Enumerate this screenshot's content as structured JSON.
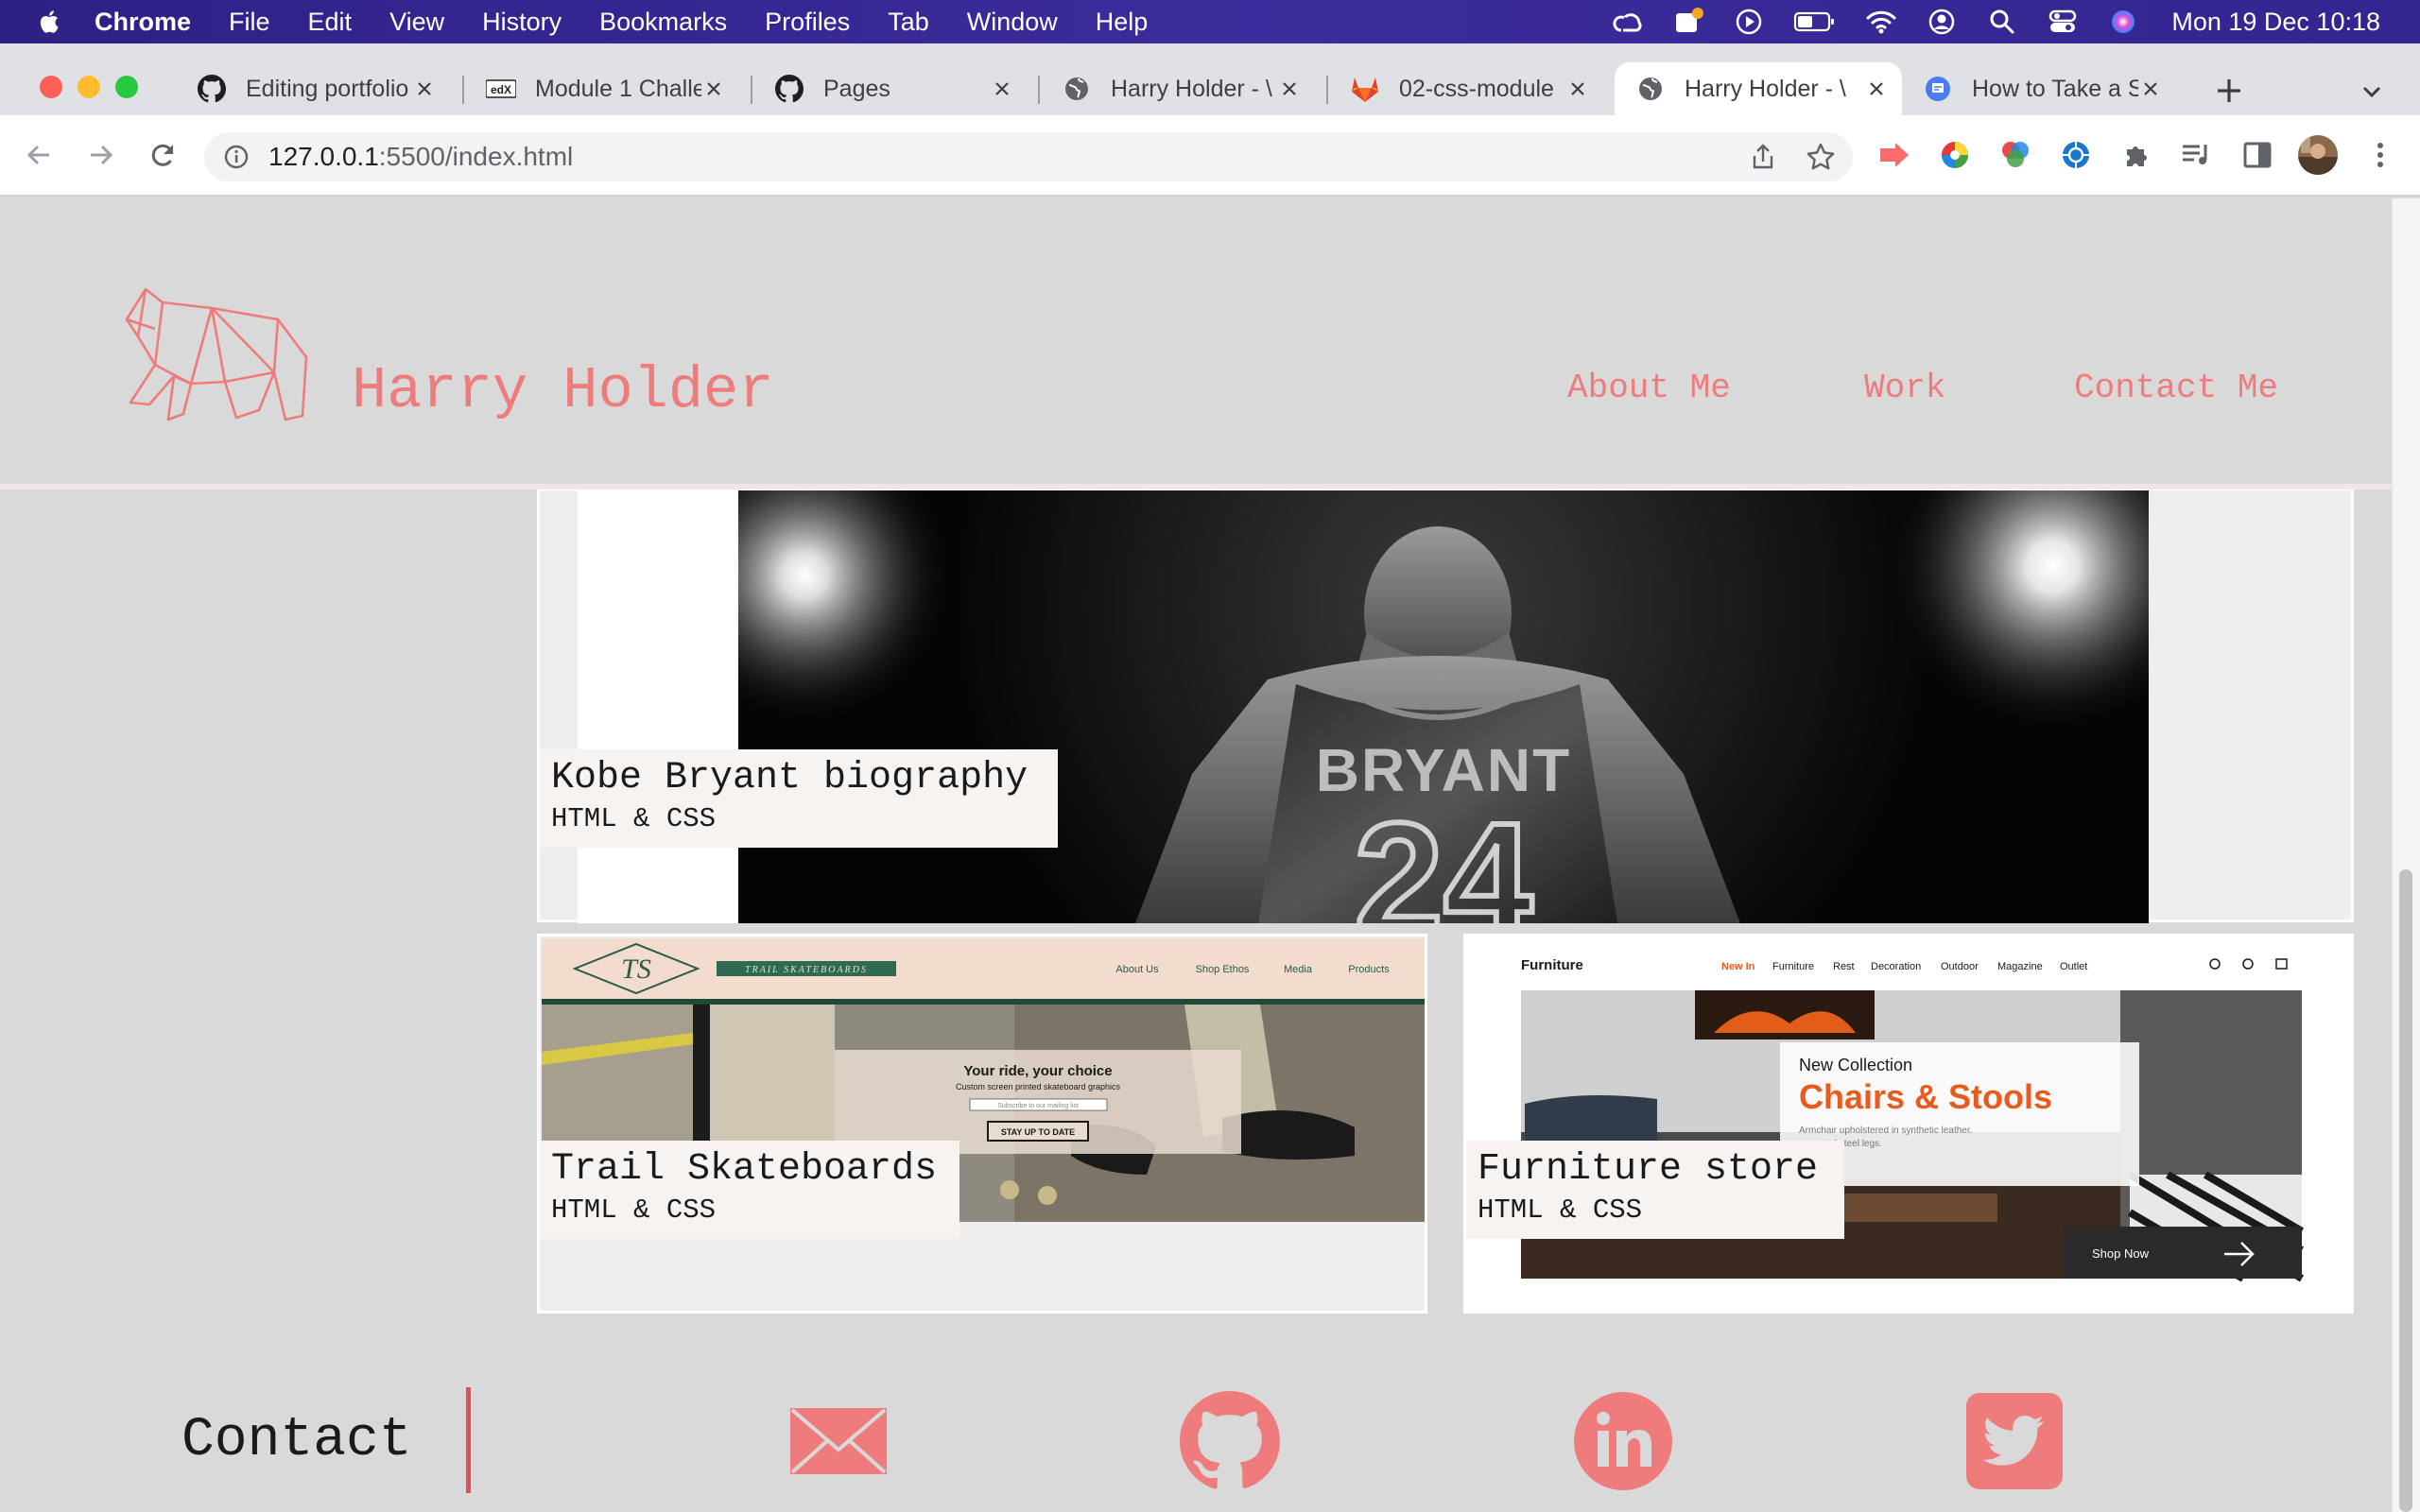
{
  "menubar": {
    "app": "Chrome",
    "menus": [
      "File",
      "Edit",
      "View",
      "History",
      "Bookmarks",
      "Profiles",
      "Tab",
      "Window",
      "Help"
    ],
    "clock": "Mon 19 Dec  10:18",
    "status_icons": [
      "creative-cloud-icon",
      "notification-icon",
      "play-icon",
      "battery-icon",
      "wifi-icon",
      "user-icon",
      "spotlight-icon",
      "control-center-icon",
      "siri-icon"
    ]
  },
  "tabs": [
    {
      "title": "Editing portfolio",
      "icon": "github-icon"
    },
    {
      "title": "Module 1 Challe",
      "icon": "edx-icon"
    },
    {
      "title": "Pages",
      "icon": "github-icon"
    },
    {
      "title": "Harry Holder - \\",
      "icon": "globe-icon"
    },
    {
      "title": "02-css-module",
      "icon": "gitlab-icon"
    },
    {
      "title": "Harry Holder - \\",
      "icon": "globe-icon",
      "active": true
    },
    {
      "title": "How to Take a S",
      "icon": "doc-icon"
    }
  ],
  "toolbar": {
    "url_host": "127.0.0.1",
    "url_rest": ":5500/index.html"
  },
  "site": {
    "name": "Harry Holder",
    "nav": [
      "About Me",
      "Work",
      "Contact Me"
    ],
    "accent": "#ef7c7c"
  },
  "projects": [
    {
      "title": "Kobe Bryant biography",
      "subtitle": "HTML & CSS",
      "image_text": "BRYANT"
    },
    {
      "title": "Trail Skateboards",
      "subtitle": "HTML & CSS",
      "shot": {
        "brand": "TS",
        "banner": "TRAIL SKATEBOARDS",
        "nav": [
          "About Us",
          "Shop Ethos",
          "Media",
          "Products"
        ],
        "headline": "Your ride, your choice",
        "sub": "Custom screen printed skateboard graphics",
        "input": "Subscribe to our mailing list",
        "button": "STAY UP TO DATE"
      }
    },
    {
      "title": "Furniture store",
      "subtitle": "HTML & CSS",
      "shot": {
        "brand": "Furniture",
        "nav": [
          "New In",
          "Furniture",
          "Rest",
          "Decoration",
          "Outdoor",
          "Magazine",
          "Outlet"
        ],
        "kicker": "New Collection",
        "headline": "Chairs & Stools",
        "sub": "Armchair upholstered in synthetic leather.",
        "sub2": "coated steel legs.",
        "button": "Shop Now"
      }
    }
  ],
  "contact": {
    "label": "Contact",
    "links": [
      "email-icon",
      "github-icon",
      "linkedin-icon",
      "twitter-icon"
    ]
  }
}
